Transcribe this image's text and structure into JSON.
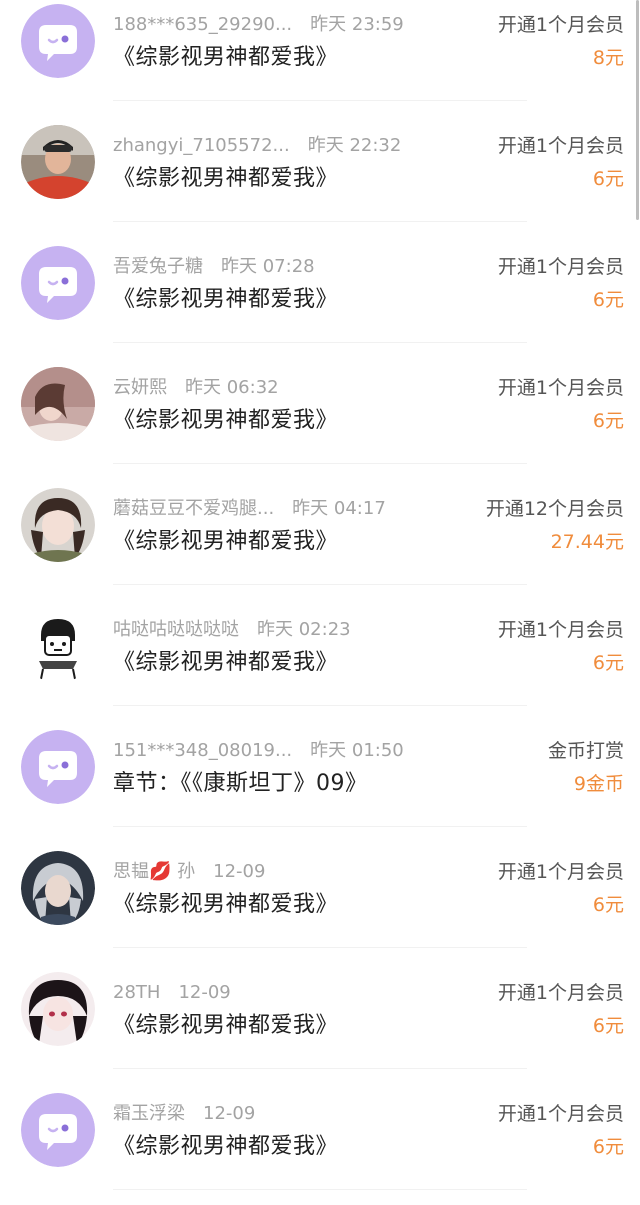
{
  "items": [
    {
      "user": "188***635_29290...",
      "time": "昨天 23:59",
      "title": "《综影视男神都爱我》",
      "kind": "开通1个月会员",
      "amount": "8元",
      "avatar": "default-avatar-icon"
    },
    {
      "user": "zhangyi_7105572...",
      "time": "昨天 22:32",
      "title": "《综影视男神都爱我》",
      "kind": "开通1个月会员",
      "amount": "6元",
      "avatar": "photo-avatar"
    },
    {
      "user": "吾爱兔子糖",
      "time": "昨天 07:28",
      "title": "《综影视男神都爱我》",
      "kind": "开通1个月会员",
      "amount": "6元",
      "avatar": "default-avatar-icon"
    },
    {
      "user": "云妍熙",
      "time": "昨天 06:32",
      "title": "《综影视男神都爱我》",
      "kind": "开通1个月会员",
      "amount": "6元",
      "avatar": "photo-avatar"
    },
    {
      "user": "蘑菇豆豆不爱鸡腿...",
      "time": "昨天 04:17",
      "title": "《综影视男神都爱我》",
      "kind": "开通12个月会员",
      "amount": "27.44元",
      "avatar": "photo-avatar"
    },
    {
      "user": "咕哒咕哒哒哒哒",
      "time": "昨天 02:23",
      "title": "《综影视男神都爱我》",
      "kind": "开通1个月会员",
      "amount": "6元",
      "avatar": "cartoon-avatar"
    },
    {
      "user": "151***348_08019...",
      "time": "昨天 01:50",
      "title": "章节：《《康斯坦丁》09》",
      "kind": "金币打赏",
      "amount": "9金币",
      "avatar": "default-avatar-icon"
    },
    {
      "user": "思韫💋 孙",
      "time": "12-09",
      "title": "《综影视男神都爱我》",
      "kind": "开通1个月会员",
      "amount": "6元",
      "avatar": "photo-avatar"
    },
    {
      "user": "28TH",
      "time": "12-09",
      "title": "《综影视男神都爱我》",
      "kind": "开通1个月会员",
      "amount": "6元",
      "avatar": "photo-avatar"
    },
    {
      "user": "霜玉浮梁",
      "time": "12-09",
      "title": "《综影视男神都爱我》",
      "kind": "开通1个月会员",
      "amount": "6元",
      "avatar": "default-avatar-icon"
    }
  ],
  "colors": {
    "accent": "#f08c3c",
    "default_avatar_bg": "#c6b2f1",
    "muted_text": "#a3a3a3",
    "main_text": "#222222"
  }
}
